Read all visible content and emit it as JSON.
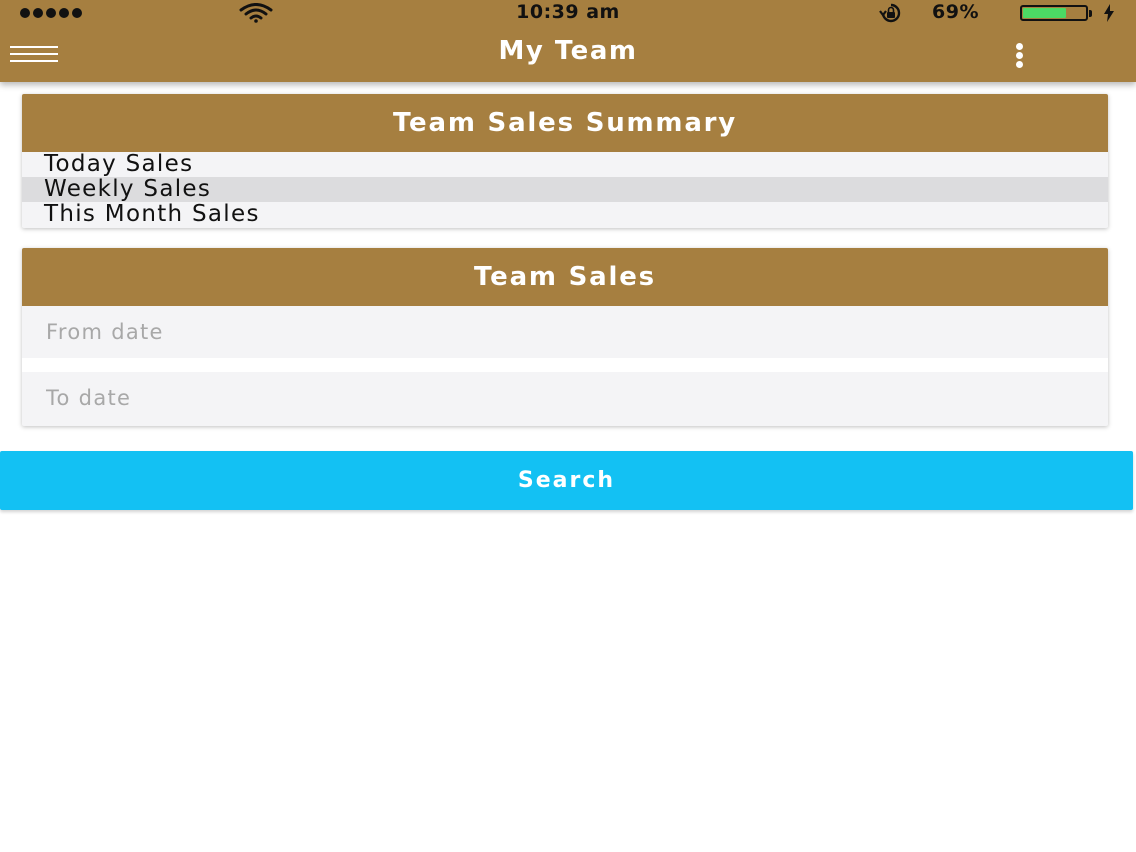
{
  "status_bar": {
    "time": "10:39 am",
    "battery_percent": "69%",
    "battery_level": 0.69,
    "signal_bars": 5,
    "icons": [
      "signal-dots-icon",
      "wifi-icon",
      "rotation-lock-icon",
      "battery-icon",
      "charging-bolt-icon"
    ]
  },
  "nav": {
    "title": "My Team",
    "menu_icon": "hamburger-menu-icon",
    "more_icon": "more-vertical-icon"
  },
  "summary_card": {
    "title": "Team Sales Summary",
    "items": [
      {
        "label": "Today Sales",
        "selected": false
      },
      {
        "label": "Weekly Sales",
        "selected": true
      },
      {
        "label": "This Month Sales",
        "selected": false
      }
    ]
  },
  "sales_card": {
    "title": "Team Sales",
    "from_date": {
      "placeholder": "From date",
      "value": ""
    },
    "to_date": {
      "placeholder": "To date",
      "value": ""
    }
  },
  "search_button": {
    "label": "Search"
  },
  "colors": {
    "header": "#a67f40",
    "accent_button": "#13c1f3",
    "battery_fill": "#4cd964",
    "selected_row": "#dcdcde"
  }
}
